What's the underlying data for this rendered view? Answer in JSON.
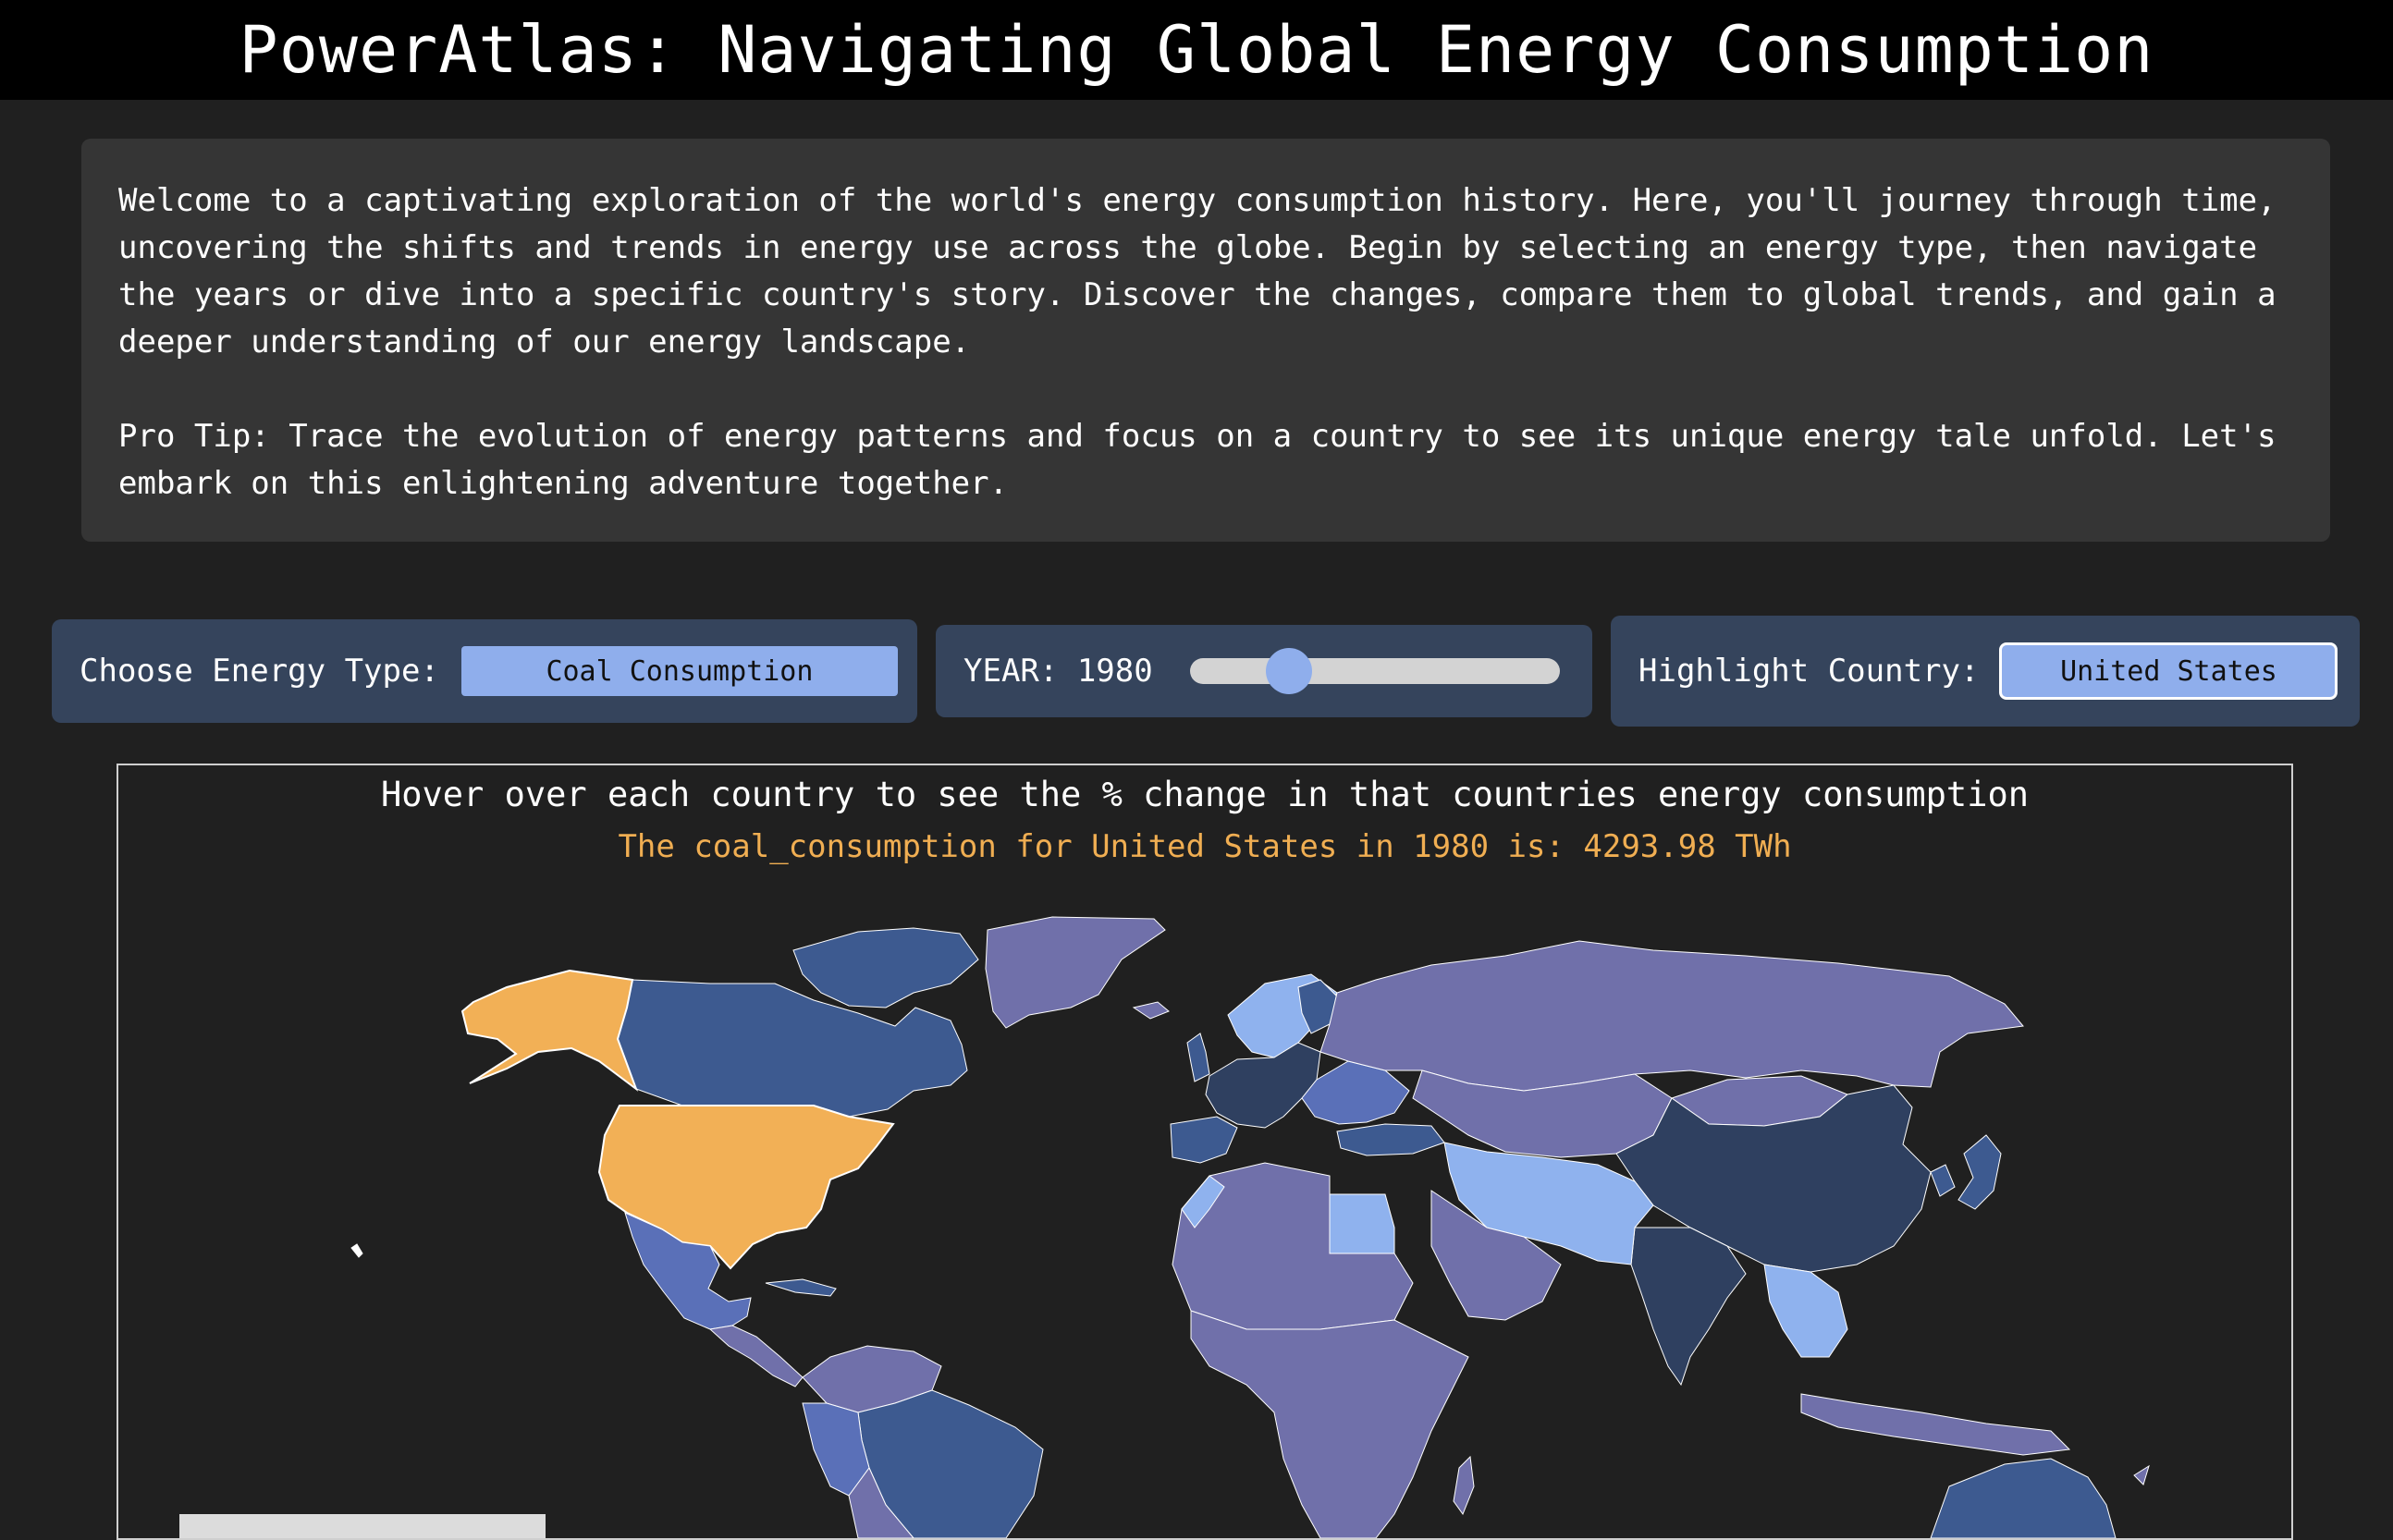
{
  "header": {
    "title": "PowerAtlas: Navigating Global Energy Consumption"
  },
  "intro": {
    "paragraph1": "Welcome to a captivating exploration of the world's energy consumption history. Here, you'll journey through time, uncovering the shifts and trends in energy use across the globe. Begin by selecting an energy type, then navigate the years or dive into a specific country's story. Discover the changes, compare them to global trends, and gain a deeper understanding of our energy landscape.",
    "paragraph2": "Pro Tip: Trace the evolution of energy patterns and focus on a country to see its unique energy tale unfold. Let's embark on this enlightening adventure together."
  },
  "controls": {
    "energy_label": "Choose Energy Type:",
    "energy_value": "Coal Consumption",
    "year_label": "YEAR: 1980",
    "year_value": 1980,
    "country_label": "Highlight Country:",
    "country_value": "United States"
  },
  "map": {
    "title": "Hover over each country to see the % change in that countries energy consumption",
    "info": "The coal_consumption for United States in 1980 is: 4293.98 TWh",
    "highlight_color": "#f2b056",
    "palette": [
      "#7070aa",
      "#5a70b8",
      "#3d5a90",
      "#2f4060",
      "#8fb2ee",
      "#f2b056"
    ]
  }
}
